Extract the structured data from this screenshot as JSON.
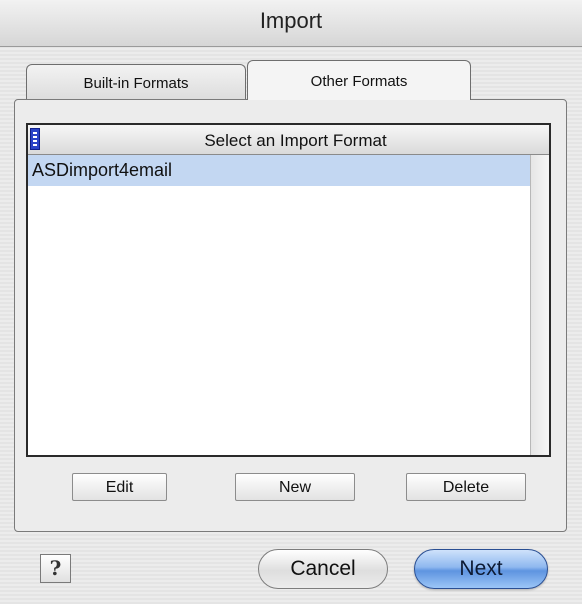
{
  "window": {
    "title": "Import"
  },
  "tabs": [
    {
      "label": "Built-in Formats",
      "selected": false
    },
    {
      "label": "Other Formats",
      "selected": true
    }
  ],
  "list": {
    "header": "Select an Import Format",
    "items": [
      {
        "label": "ASDimport4email",
        "selected": true
      }
    ]
  },
  "list_buttons": {
    "edit": "Edit",
    "new": "New",
    "delete": "Delete"
  },
  "footer": {
    "help": "?",
    "cancel": "Cancel",
    "next": "Next"
  },
  "colors": {
    "selection": "#c3d7f2",
    "default_button": "#5e94e0",
    "header_icon": "#2b43c7"
  }
}
